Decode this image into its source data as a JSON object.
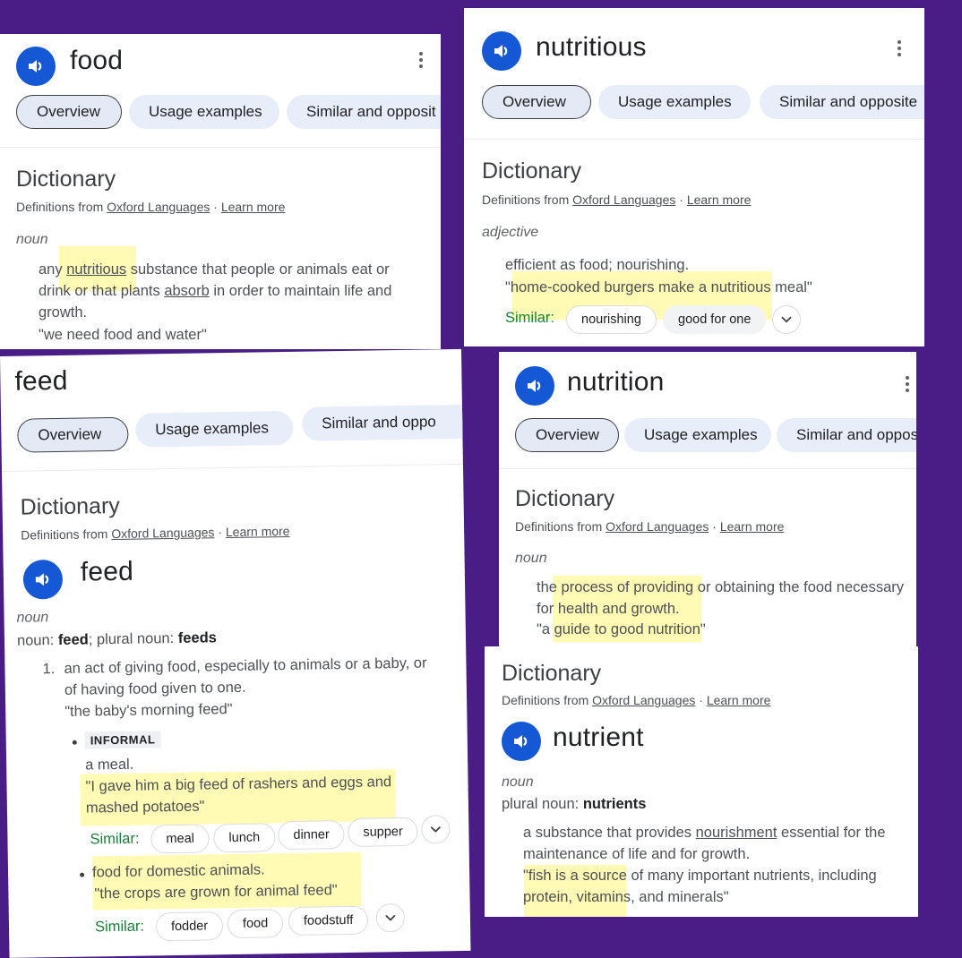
{
  "background_color": "#4a1d86",
  "accent_color": "#1558d6",
  "highlight_color": "#fff78c",
  "common": {
    "tabs": [
      "Overview",
      "Usage examples",
      "Similar and opposite"
    ],
    "dictionary_heading": "Dictionary",
    "source_prefix": "Definitions from",
    "source_link": "Oxford Languages",
    "source_sep": "·",
    "learn_more": "Learn more",
    "similar_label": "Similar:",
    "speaker_icon": "volume-up-icon",
    "more_icon": "more-vert-icon",
    "expand_icon": "chevron-down-icon"
  },
  "food": {
    "word": "food",
    "tabs_visible": [
      "Overview",
      "Usage examples",
      "Similar and opposit"
    ],
    "pos": "noun",
    "def_parts": [
      "any ",
      "nutritious",
      " substance that people or animals eat or drink or that plants ",
      "absorb",
      " in order to maintain life and growth."
    ],
    "example": "\"we need food and water\""
  },
  "feed": {
    "title": "feed",
    "tabs_visible": [
      "Overview",
      "Usage examples",
      "Similar and oppo"
    ],
    "word": "feed",
    "pos": "noun",
    "forms": {
      "prefix": "noun: ",
      "singular": "feed",
      "mid": "; plural noun: ",
      "plural": "feeds"
    },
    "sense1": {
      "number": "1.",
      "definition": "an act of giving food, especially to animals or a baby, or of having food given to one.",
      "example": "\"the baby's morning feed\""
    },
    "sub1": {
      "register": "INFORMAL",
      "definition": "a meal.",
      "example_line1": "\"I gave him a big feed of rashers and eggs and",
      "example_line2": "mashed potatoes\"",
      "similar": [
        "meal",
        "lunch",
        "dinner",
        "supper"
      ]
    },
    "sub2": {
      "definition": "food for domestic animals.",
      "example": "\"the crops are grown for animal feed\"",
      "similar": [
        "fodder",
        "food",
        "foodstuff"
      ]
    }
  },
  "nutritious": {
    "word": "nutritious",
    "tabs_visible": [
      "Overview",
      "Usage examples",
      "Similar and opposite"
    ],
    "pos": "adjective",
    "definition": "efficient as food; nourishing.",
    "example": "\"home-cooked burgers make a nutritious meal\"",
    "similar": [
      "nourishing",
      "good for one"
    ]
  },
  "nutrition": {
    "word": "nutrition",
    "tabs_visible": [
      "Overview",
      "Usage examples",
      "Similar and oppos"
    ],
    "pos": "noun",
    "definition": "the process of providing or obtaining the food necessary for health and growth.",
    "example": "\"a guide to good nutrition\""
  },
  "nutrient": {
    "word": "nutrient",
    "pos": "noun",
    "forms": {
      "prefix": "plural noun: ",
      "plural": "nutrients"
    },
    "def_parts": [
      "a substance that provides ",
      "nourishment",
      " essential for the maintenance of life and for growth."
    ],
    "example": "\"fish is a source of many important nutrients, including protein, vitamins, and minerals\""
  }
}
